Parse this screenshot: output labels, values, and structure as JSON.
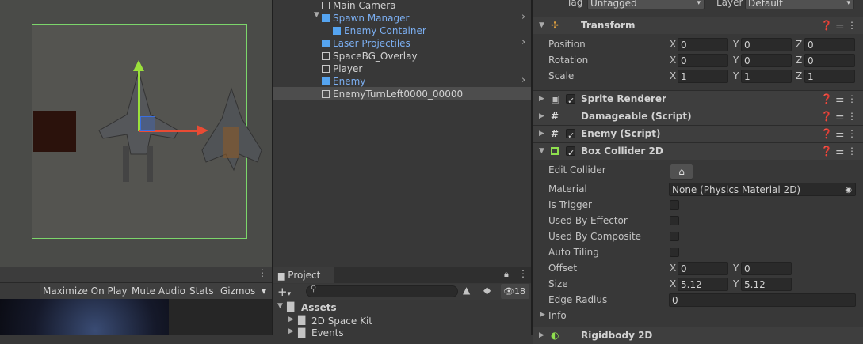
{
  "hierarchy": {
    "items": [
      {
        "label": "Main Camera",
        "prefab": false,
        "arrow": false
      },
      {
        "label": "Spawn Manager",
        "prefab": true,
        "arrow": true
      },
      {
        "label": "Enemy Container",
        "prefab": true,
        "arrow": false
      },
      {
        "label": "Laser Projectiles",
        "prefab": true,
        "arrow": true
      },
      {
        "label": "SpaceBG_Overlay",
        "prefab": false,
        "arrow": false
      },
      {
        "label": "Player",
        "prefab": false,
        "arrow": false
      },
      {
        "label": "Enemy",
        "prefab": true,
        "arrow": true
      },
      {
        "label": "EnemyTurnLeft0000_00000",
        "prefab": false,
        "arrow": false
      }
    ]
  },
  "game_toolbar": {
    "maximize": "Maximize On Play",
    "mute": "Mute Audio",
    "stats": "Stats",
    "gizmos": "Gizmos"
  },
  "project": {
    "tab": "Project",
    "hidden_count": "18",
    "assets": "Assets",
    "folder1": "2D Space Kit",
    "folder2": "Events"
  },
  "inspector": {
    "tag_label": "Tag",
    "tag_value": "Untagged",
    "layer_label": "Layer",
    "layer_value": "Default",
    "transform": {
      "title": "Transform",
      "position_label": "Position",
      "rotation_label": "Rotation",
      "scale_label": "Scale",
      "position": {
        "x": "0",
        "y": "0",
        "z": "0"
      },
      "rotation": {
        "x": "0",
        "y": "0",
        "z": "0"
      },
      "scale": {
        "x": "1",
        "y": "1",
        "z": "1"
      }
    },
    "components": {
      "sprite_renderer": "Sprite Renderer",
      "damageable": "Damageable (Script)",
      "enemy": "Enemy (Script)",
      "box_collider": "Box Collider 2D"
    },
    "box_collider": {
      "edit_collider": "Edit Collider",
      "material_label": "Material",
      "material_value": "None (Physics Material 2D)",
      "is_trigger": "Is Trigger",
      "used_by_effector": "Used By Effector",
      "used_by_composite": "Used By Composite",
      "auto_tiling": "Auto Tiling",
      "offset_label": "Offset",
      "offset": {
        "x": "0",
        "y": "0"
      },
      "size_label": "Size",
      "size": {
        "x": "5.12",
        "y": "5.12"
      },
      "edge_radius_label": "Edge Radius",
      "edge_radius": "0",
      "info": "Info"
    },
    "next_component": "Rigidbody 2D"
  },
  "axes": {
    "x": "X",
    "y": "Y",
    "z": "Z"
  },
  "colors": {
    "accent_blue": "#7baef0",
    "selection": "#4d4d4d",
    "camera_frame": "#7cd66b"
  }
}
